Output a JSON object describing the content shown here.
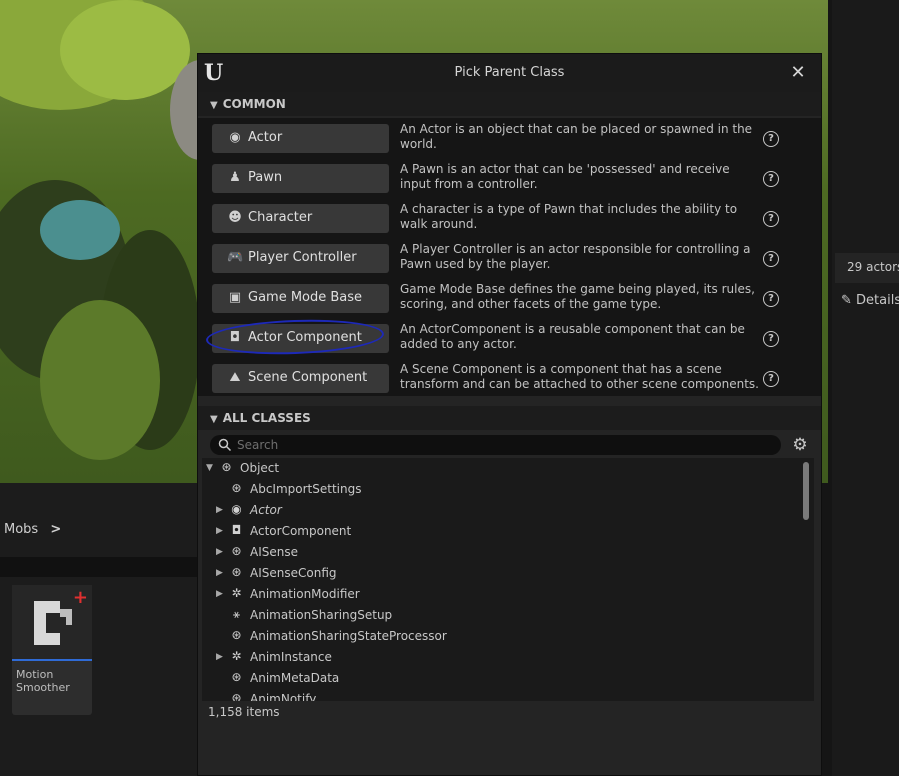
{
  "outliner": {
    "actors_count": "29 actors",
    "details_tab": "Details"
  },
  "content_browser": {
    "path_segment": "Mobs",
    "path_chevron": ">",
    "asset": {
      "name": "Motion Smoother",
      "icon": "actor-component-blueprint-icon"
    }
  },
  "dialog": {
    "title": "Pick Parent Class",
    "close_label": "✕",
    "common_header": "COMMON",
    "all_classes_header": "ALL CLASSES",
    "common_classes": [
      {
        "label": "Actor",
        "icon": "actor-icon",
        "glyph": "◉",
        "description": "An Actor is an object that can be placed or spawned in the world."
      },
      {
        "label": "Pawn",
        "icon": "pawn-icon",
        "glyph": "♟",
        "description": "A Pawn is an actor that can be 'possessed' and receive input from a controller."
      },
      {
        "label": "Character",
        "icon": "character-icon",
        "glyph": "☻",
        "description": "A character is a type of Pawn that includes the ability to walk around."
      },
      {
        "label": "Player Controller",
        "icon": "gamepad-icon",
        "glyph": "🎮",
        "description": "A Player Controller is an actor responsible for controlling a Pawn used by the player."
      },
      {
        "label": "Game Mode Base",
        "icon": "game-mode-icon",
        "glyph": "▣",
        "description": "Game Mode Base defines the game being played, its rules, scoring, and other facets of the game type."
      },
      {
        "label": "Actor Component",
        "icon": "actor-component-icon",
        "glyph": "◘",
        "description": "An ActorComponent is a reusable component that can be added to any actor."
      },
      {
        "label": "Scene Component",
        "icon": "scene-component-icon",
        "glyph": "⛰",
        "description": "A Scene Component is a component that has a scene transform and can be attached to other scene components."
      }
    ],
    "search_placeholder": "Search",
    "tree": [
      {
        "label": "Object",
        "depth": 0,
        "expanded": true,
        "has_children": true,
        "icon": "object-icon",
        "glyph": "⊛",
        "italic": false
      },
      {
        "label": "AbcImportSettings",
        "depth": 1,
        "has_children": false,
        "icon": "object-icon",
        "glyph": "⊛",
        "italic": false
      },
      {
        "label": "Actor",
        "depth": 1,
        "has_children": true,
        "icon": "actor-icon",
        "glyph": "◉",
        "italic": true
      },
      {
        "label": "ActorComponent",
        "depth": 1,
        "has_children": true,
        "icon": "actor-component-icon",
        "glyph": "◘",
        "italic": false
      },
      {
        "label": "AISense",
        "depth": 1,
        "has_children": true,
        "icon": "object-icon",
        "glyph": "⊛",
        "italic": false
      },
      {
        "label": "AISenseConfig",
        "depth": 1,
        "has_children": true,
        "icon": "object-icon",
        "glyph": "⊛",
        "italic": false
      },
      {
        "label": "AnimationModifier",
        "depth": 1,
        "has_children": true,
        "icon": "animation-icon",
        "glyph": "✲",
        "italic": false
      },
      {
        "label": "AnimationSharingSetup",
        "depth": 1,
        "has_children": false,
        "icon": "skeleton-icon",
        "glyph": "⚹",
        "italic": false
      },
      {
        "label": "AnimationSharingStateProcessor",
        "depth": 1,
        "has_children": false,
        "icon": "object-icon",
        "glyph": "⊛",
        "italic": false
      },
      {
        "label": "AnimInstance",
        "depth": 1,
        "has_children": true,
        "icon": "animation-icon",
        "glyph": "✲",
        "italic": false
      },
      {
        "label": "AnimMetaData",
        "depth": 1,
        "has_children": false,
        "icon": "object-icon",
        "glyph": "⊛",
        "italic": false
      },
      {
        "label": "AnimNotify",
        "depth": 1,
        "has_children": false,
        "icon": "object-icon",
        "glyph": "⊛",
        "italic": false
      }
    ],
    "item_count": "1,158 items"
  }
}
